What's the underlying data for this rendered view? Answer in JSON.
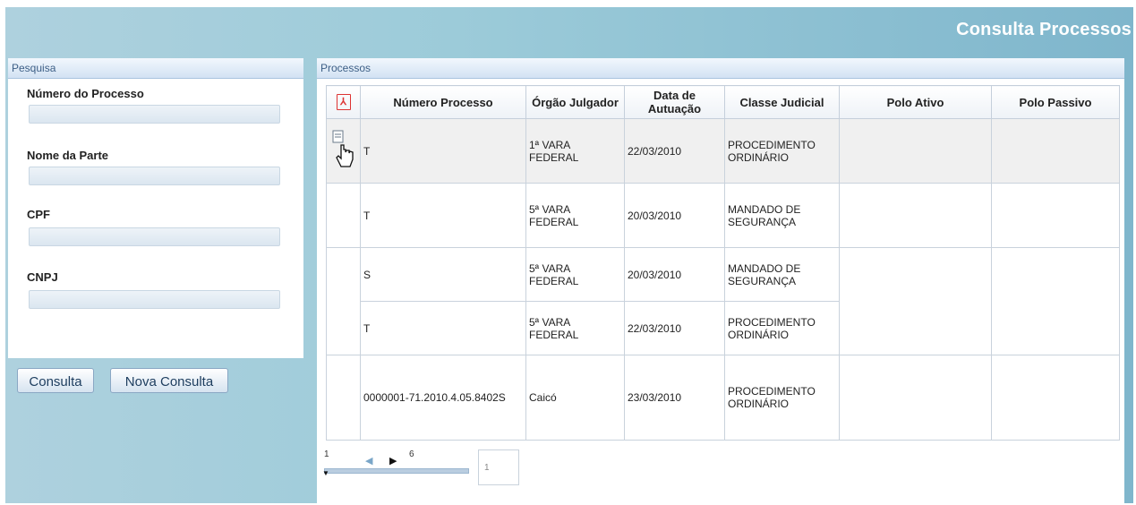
{
  "app": {
    "title": "Consulta Processos"
  },
  "search_panel": {
    "header": "Pesquisa",
    "fields": [
      {
        "label": "Número do Processo",
        "value": ""
      },
      {
        "label": "Nome da Parte",
        "value": ""
      },
      {
        "label": "CPF",
        "value": ""
      },
      {
        "label": "CNPJ",
        "value": ""
      }
    ],
    "consulta_label": "Consulta",
    "nova_consulta_label": "Nova Consulta"
  },
  "results_panel": {
    "header": "Processos",
    "columns": [
      "Número Processo",
      "Órgão Julgador",
      "Data de Autuação",
      "Classe Judicial",
      "Polo Ativo",
      "Polo Passivo"
    ],
    "rows": [
      {
        "numero": "T",
        "orgao": "1ª VARA FEDERAL",
        "data": "22/03/2010",
        "classe": "PROCEDIMENTO ORDINÁRIO",
        "polo_ativo": "",
        "polo_passivo": ""
      },
      {
        "numero": "T",
        "orgao": "5ª VARA FEDERAL",
        "data": "20/03/2010",
        "classe": "MANDADO DE SEGURANÇA",
        "polo_ativo": "",
        "polo_passivo": ""
      },
      {
        "numero": "S",
        "orgao": "5ª VARA FEDERAL",
        "data": "20/03/2010",
        "classe": "MANDADO DE SEGURANÇA",
        "polo_ativo": "",
        "polo_passivo": ""
      },
      {
        "numero": "T",
        "orgao": "5ª VARA FEDERAL",
        "data": "22/03/2010",
        "classe": "PROCEDIMENTO ORDINÁRIO",
        "polo_ativo": "",
        "polo_passivo": ""
      },
      {
        "numero": "0000001-71.2010.4.05.8402S",
        "orgao": "Caicó",
        "data": "23/03/2010",
        "classe": "PROCEDIMENTO ORDINÁRIO",
        "polo_ativo": "",
        "polo_passivo": ""
      }
    ],
    "pager": {
      "min": "1",
      "max": "6",
      "page": "1"
    }
  },
  "icons": {
    "export": "pdf-icon",
    "row_action": "view-document-icon",
    "cursor": "hand-pointer-icon"
  }
}
